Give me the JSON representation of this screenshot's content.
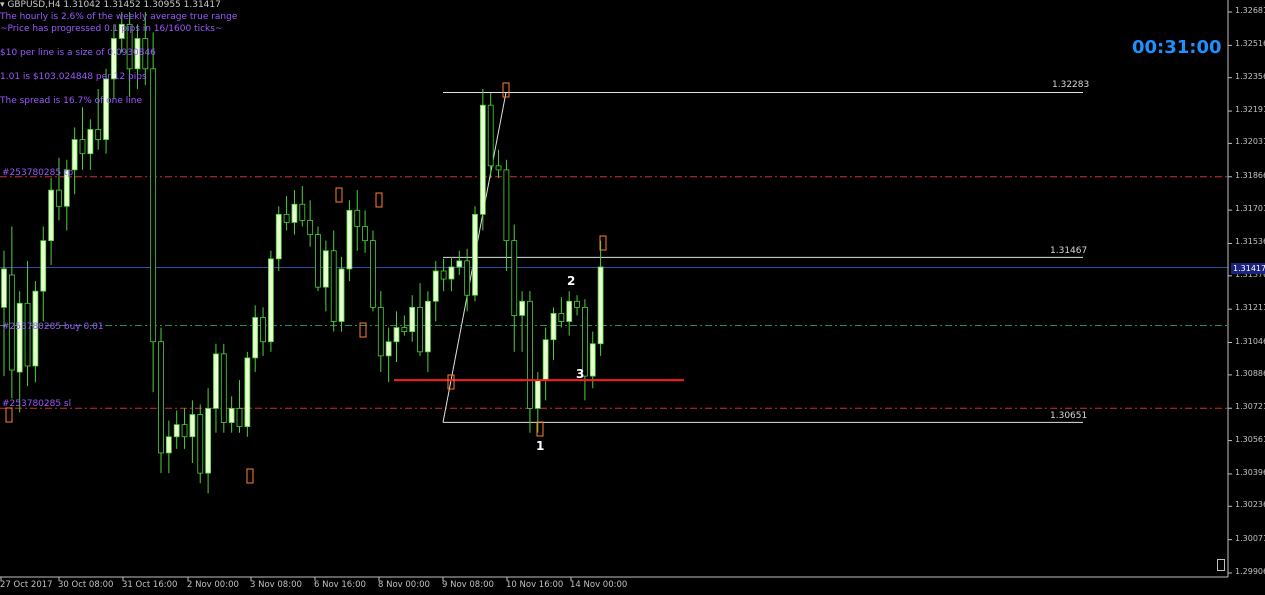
{
  "window": {
    "symbol_title": "▾ GBPUSD,H4  1.31042 1.31452 1.30955 1.31417",
    "countdown": "00:31:00"
  },
  "info": {
    "hourly": "The hourly is 2.6% of the weekly average true range",
    "progress": "~Price has progressed  0.1  pips in 16/1600 ticks~",
    "per_line": "$10 per line is a size of 0.0930846",
    "lot_value": "1.01 is $103.024848 per 12 pips",
    "spread": "The spread is 16.7% of one line"
  },
  "orders": {
    "tp": "#253780285 tp",
    "buy": "#253780285 buy  0.01",
    "sl": "#253780285 sl"
  },
  "levels": {
    "high": "1.32283",
    "mid": "1.31467",
    "low": "1.30651"
  },
  "wave_labels": {
    "one": "1",
    "two": "2",
    "three": "3"
  },
  "price_axis": {
    "current": "1.31417",
    "ticks": [
      "1.32681",
      "1.32516",
      "1.32356",
      "1.32191",
      "1.32031",
      "1.31866",
      "1.31701",
      "1.31536",
      "1.31376",
      "1.31211",
      "1.31046",
      "1.30886",
      "1.30721",
      "1.30561",
      "1.30396",
      "1.30236",
      "1.30071",
      "1.29906"
    ]
  },
  "time_axis": {
    "ticks": [
      "27 Oct 2017",
      "30 Oct 08:00",
      "31 Oct 16:00",
      "2 Nov 00:00",
      "3 Nov 08:00",
      "6 Nov 16:00",
      "8 Nov 00:00",
      "9 Nov 08:00",
      "10 Nov 16:00",
      "14 Nov 00:00"
    ]
  },
  "colors": {
    "background": "#000000",
    "bull_candle": "#e8ffd0",
    "bear_candle": "#000000",
    "candle_outline": "#4cd137",
    "tp_sl_line": "#d32f2f",
    "buy_line": "#2e8b57",
    "support_line": "#ff1a1a",
    "current_price_line": "#3949ab",
    "fib_lines": "#e0e0e0",
    "timer": "#1e90ff",
    "info_text": "#9b59ff"
  },
  "chart_data": {
    "type": "candlestick",
    "symbol": "GBPUSD",
    "timeframe": "H4",
    "ylim": [
      1.29906,
      1.32681
    ],
    "horizontal_lines": {
      "take_profit": 1.31866,
      "buy_entry": 1.3113,
      "stop_loss": 1.30721,
      "support": 1.3086,
      "current": 1.31417
    },
    "fibonacci_levels": [
      1.32283,
      1.31467,
      1.30651
    ],
    "candles": [
      {
        "o": 1.3122,
        "h": 1.315,
        "l": 1.3088,
        "c": 1.3141
      },
      {
        "o": 1.3138,
        "h": 1.3162,
        "l": 1.3077,
        "c": 1.3091
      },
      {
        "o": 1.309,
        "h": 1.313,
        "l": 1.307,
        "c": 1.3124
      },
      {
        "o": 1.3124,
        "h": 1.3145,
        "l": 1.3083,
        "c": 1.3093
      },
      {
        "o": 1.3093,
        "h": 1.3135,
        "l": 1.3085,
        "c": 1.313
      },
      {
        "o": 1.313,
        "h": 1.3162,
        "l": 1.3115,
        "c": 1.3155
      },
      {
        "o": 1.3155,
        "h": 1.3186,
        "l": 1.3143,
        "c": 1.318
      },
      {
        "o": 1.318,
        "h": 1.3196,
        "l": 1.3165,
        "c": 1.3172
      },
      {
        "o": 1.3172,
        "h": 1.3195,
        "l": 1.316,
        "c": 1.319
      },
      {
        "o": 1.319,
        "h": 1.3211,
        "l": 1.3178,
        "c": 1.3205
      },
      {
        "o": 1.3205,
        "h": 1.3221,
        "l": 1.319,
        "c": 1.3198
      },
      {
        "o": 1.3198,
        "h": 1.3215,
        "l": 1.319,
        "c": 1.321
      },
      {
        "o": 1.321,
        "h": 1.323,
        "l": 1.32,
        "c": 1.3205
      },
      {
        "o": 1.3205,
        "h": 1.324,
        "l": 1.3198,
        "c": 1.3235
      },
      {
        "o": 1.3235,
        "h": 1.3262,
        "l": 1.3225,
        "c": 1.3255
      },
      {
        "o": 1.3255,
        "h": 1.3268,
        "l": 1.3248,
        "c": 1.3262
      },
      {
        "o": 1.3262,
        "h": 1.3268,
        "l": 1.3226,
        "c": 1.324
      },
      {
        "o": 1.324,
        "h": 1.3262,
        "l": 1.323,
        "c": 1.3255
      },
      {
        "o": 1.3255,
        "h": 1.3268,
        "l": 1.3232,
        "c": 1.324
      },
      {
        "o": 1.324,
        "h": 1.3258,
        "l": 1.308,
        "c": 1.3105
      },
      {
        "o": 1.3105,
        "h": 1.3112,
        "l": 1.304,
        "c": 1.305
      },
      {
        "o": 1.305,
        "h": 1.3066,
        "l": 1.304,
        "c": 1.3058
      },
      {
        "o": 1.3058,
        "h": 1.3071,
        "l": 1.3052,
        "c": 1.3064
      },
      {
        "o": 1.3064,
        "h": 1.3072,
        "l": 1.3052,
        "c": 1.3058
      },
      {
        "o": 1.3058,
        "h": 1.3076,
        "l": 1.3045,
        "c": 1.3069
      },
      {
        "o": 1.3069,
        "h": 1.3074,
        "l": 1.3035,
        "c": 1.304
      },
      {
        "o": 1.304,
        "h": 1.3082,
        "l": 1.303,
        "c": 1.3072
      },
      {
        "o": 1.3072,
        "h": 1.3104,
        "l": 1.306,
        "c": 1.3099
      },
      {
        "o": 1.3099,
        "h": 1.3104,
        "l": 1.306,
        "c": 1.3065
      },
      {
        "o": 1.3065,
        "h": 1.3078,
        "l": 1.306,
        "c": 1.3072
      },
      {
        "o": 1.3072,
        "h": 1.3086,
        "l": 1.306,
        "c": 1.3063
      },
      {
        "o": 1.3063,
        "h": 1.31,
        "l": 1.3058,
        "c": 1.3097
      },
      {
        "o": 1.3097,
        "h": 1.3123,
        "l": 1.309,
        "c": 1.3117
      },
      {
        "o": 1.3117,
        "h": 1.3122,
        "l": 1.3098,
        "c": 1.3105
      },
      {
        "o": 1.3105,
        "h": 1.315,
        "l": 1.31,
        "c": 1.3146
      },
      {
        "o": 1.3146,
        "h": 1.3172,
        "l": 1.314,
        "c": 1.3168
      },
      {
        "o": 1.3168,
        "h": 1.3177,
        "l": 1.316,
        "c": 1.3164
      },
      {
        "o": 1.3164,
        "h": 1.318,
        "l": 1.3158,
        "c": 1.3173
      },
      {
        "o": 1.3173,
        "h": 1.3182,
        "l": 1.3162,
        "c": 1.3165
      },
      {
        "o": 1.3165,
        "h": 1.3175,
        "l": 1.3152,
        "c": 1.3158
      },
      {
        "o": 1.3158,
        "h": 1.3162,
        "l": 1.313,
        "c": 1.3132
      },
      {
        "o": 1.3132,
        "h": 1.3155,
        "l": 1.312,
        "c": 1.315
      },
      {
        "o": 1.315,
        "h": 1.316,
        "l": 1.311,
        "c": 1.3115
      },
      {
        "o": 1.3115,
        "h": 1.3147,
        "l": 1.311,
        "c": 1.3141
      },
      {
        "o": 1.3141,
        "h": 1.3175,
        "l": 1.3135,
        "c": 1.317
      },
      {
        "o": 1.317,
        "h": 1.318,
        "l": 1.315,
        "c": 1.3162
      },
      {
        "o": 1.3162,
        "h": 1.317,
        "l": 1.3149,
        "c": 1.3155
      },
      {
        "o": 1.3155,
        "h": 1.316,
        "l": 1.312,
        "c": 1.3122
      },
      {
        "o": 1.3122,
        "h": 1.313,
        "l": 1.309,
        "c": 1.3098
      },
      {
        "o": 1.3098,
        "h": 1.3112,
        "l": 1.3085,
        "c": 1.3105
      },
      {
        "o": 1.3105,
        "h": 1.312,
        "l": 1.3095,
        "c": 1.3112
      },
      {
        "o": 1.3112,
        "h": 1.3118,
        "l": 1.3108,
        "c": 1.311
      },
      {
        "o": 1.311,
        "h": 1.3128,
        "l": 1.3105,
        "c": 1.3122
      },
      {
        "o": 1.3122,
        "h": 1.3134,
        "l": 1.3098,
        "c": 1.31
      },
      {
        "o": 1.31,
        "h": 1.313,
        "l": 1.309,
        "c": 1.3125
      },
      {
        "o": 1.3125,
        "h": 1.3145,
        "l": 1.3115,
        "c": 1.314
      },
      {
        "o": 1.314,
        "h": 1.3146,
        "l": 1.313,
        "c": 1.3136
      },
      {
        "o": 1.3136,
        "h": 1.3147,
        "l": 1.313,
        "c": 1.3142
      },
      {
        "o": 1.3142,
        "h": 1.315,
        "l": 1.3138,
        "c": 1.3145
      },
      {
        "o": 1.3145,
        "h": 1.3151,
        "l": 1.312,
        "c": 1.3128
      },
      {
        "o": 1.3128,
        "h": 1.3172,
        "l": 1.3125,
        "c": 1.3168
      },
      {
        "o": 1.3168,
        "h": 1.323,
        "l": 1.316,
        "c": 1.3222
      },
      {
        "o": 1.3222,
        "h": 1.3228,
        "l": 1.3186,
        "c": 1.3192
      },
      {
        "o": 1.3192,
        "h": 1.32,
        "l": 1.3186,
        "c": 1.319
      },
      {
        "o": 1.319,
        "h": 1.3195,
        "l": 1.314,
        "c": 1.3155
      },
      {
        "o": 1.3155,
        "h": 1.3163,
        "l": 1.31,
        "c": 1.3118
      },
      {
        "o": 1.3118,
        "h": 1.313,
        "l": 1.31,
        "c": 1.3125
      },
      {
        "o": 1.3125,
        "h": 1.313,
        "l": 1.306,
        "c": 1.3072
      },
      {
        "o": 1.3072,
        "h": 1.309,
        "l": 1.306,
        "c": 1.3086
      },
      {
        "o": 1.3086,
        "h": 1.3112,
        "l": 1.3076,
        "c": 1.3106
      },
      {
        "o": 1.3106,
        "h": 1.3122,
        "l": 1.3096,
        "c": 1.3119
      },
      {
        "o": 1.3119,
        "h": 1.3127,
        "l": 1.3112,
        "c": 1.3115
      },
      {
        "o": 1.3115,
        "h": 1.313,
        "l": 1.3108,
        "c": 1.3125
      },
      {
        "o": 1.3125,
        "h": 1.3128,
        "l": 1.3118,
        "c": 1.3122
      },
      {
        "o": 1.3122,
        "h": 1.3126,
        "l": 1.3076,
        "c": 1.3088
      },
      {
        "o": 1.3088,
        "h": 1.311,
        "l": 1.3082,
        "c": 1.3104
      },
      {
        "o": 1.3104,
        "h": 1.3155,
        "l": 1.3098,
        "c": 1.3142
      }
    ]
  }
}
